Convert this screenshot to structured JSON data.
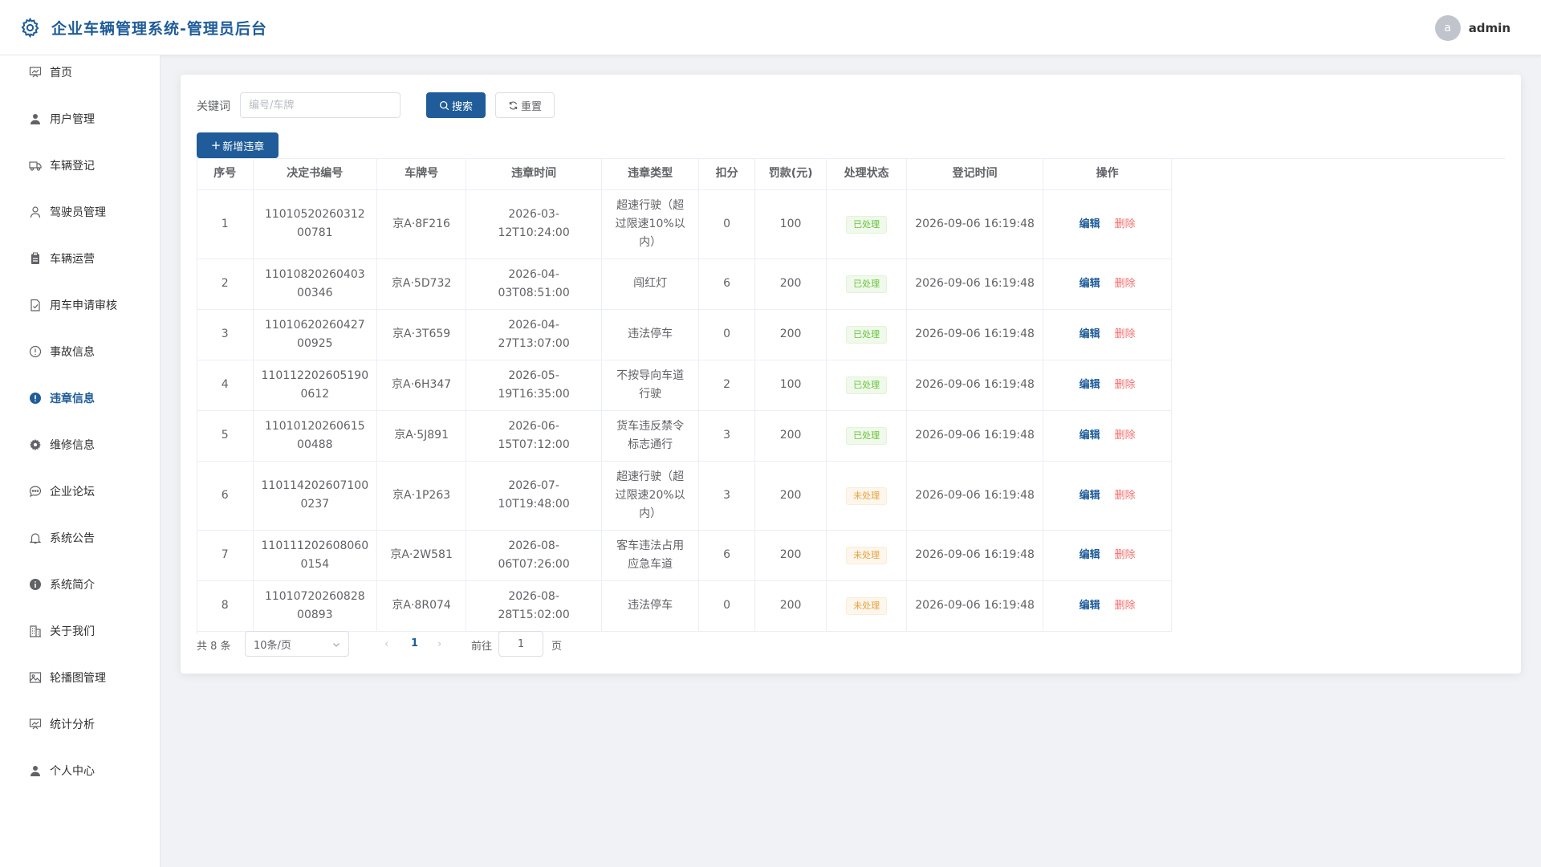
{
  "header": {
    "title": "企业车辆管理系统-管理员后台",
    "avatar_letter": "a",
    "username": "admin"
  },
  "sidebar": {
    "items": [
      {
        "label": "首页",
        "icon": "chart-board-icon",
        "name": "sidebar-item-home"
      },
      {
        "label": "用户管理",
        "icon": "user-icon",
        "name": "sidebar-item-users"
      },
      {
        "label": "车辆登记",
        "icon": "truck-icon",
        "name": "sidebar-item-vehicle-register"
      },
      {
        "label": "驾驶员管理",
        "icon": "user-outline-icon",
        "name": "sidebar-item-drivers"
      },
      {
        "label": "车辆运营",
        "icon": "clipboard-icon",
        "name": "sidebar-item-operations"
      },
      {
        "label": "用车申请审核",
        "icon": "document-check-icon",
        "name": "sidebar-item-applications"
      },
      {
        "label": "事故信息",
        "icon": "warning-outline-icon",
        "name": "sidebar-item-accidents"
      },
      {
        "label": "违章信息",
        "icon": "warning-filled-icon",
        "name": "sidebar-item-violations"
      },
      {
        "label": "维修信息",
        "icon": "gear-icon",
        "name": "sidebar-item-repairs"
      },
      {
        "label": "企业论坛",
        "icon": "chat-icon",
        "name": "sidebar-item-forum"
      },
      {
        "label": "系统公告",
        "icon": "bell-icon",
        "name": "sidebar-item-notices"
      },
      {
        "label": "系统简介",
        "icon": "info-icon",
        "name": "sidebar-item-intro"
      },
      {
        "label": "关于我们",
        "icon": "building-icon",
        "name": "sidebar-item-about"
      },
      {
        "label": "轮播图管理",
        "icon": "picture-icon",
        "name": "sidebar-item-carousel"
      },
      {
        "label": "统计分析",
        "icon": "chart-board-icon",
        "name": "sidebar-item-stats"
      },
      {
        "label": "个人中心",
        "icon": "user-icon",
        "name": "sidebar-item-profile"
      }
    ],
    "active_index": 7
  },
  "toolbar": {
    "keyword_label": "关键词",
    "keyword_placeholder": "编号/车牌",
    "search_label": "搜索",
    "reset_label": "重置",
    "add_label": "新增违章"
  },
  "table": {
    "columns": [
      "序号",
      "决定书编号",
      "车牌号",
      "违章时间",
      "违章类型",
      "扣分",
      "罚款(元)",
      "处理状态",
      "登记时间",
      "操作"
    ],
    "rows": [
      {
        "no": "1",
        "doc": [
          "11010520260312",
          "00781"
        ],
        "plate": "京A·8F216",
        "time": "2026-03-12T10:24:00",
        "type": [
          "超速行驶（超",
          "过限速10%以",
          "内）"
        ],
        "points": "0",
        "fine": "100",
        "status": "已处理",
        "done": true,
        "reg": "2026-09-06 16:19:48"
      },
      {
        "no": "2",
        "doc": [
          "11010820260403",
          "00346"
        ],
        "plate": "京A·5D732",
        "time": "2026-04-03T08:51:00",
        "type": [
          "闯红灯"
        ],
        "points": "6",
        "fine": "200",
        "status": "已处理",
        "done": true,
        "reg": "2026-09-06 16:19:48"
      },
      {
        "no": "3",
        "doc": [
          "11010620260427",
          "00925"
        ],
        "plate": "京A·3T659",
        "time": "2026-04-27T13:07:00",
        "type": [
          "违法停车"
        ],
        "points": "0",
        "fine": "200",
        "status": "已处理",
        "done": true,
        "reg": "2026-09-06 16:19:48"
      },
      {
        "no": "4",
        "doc": [
          "110112202605190",
          "0612"
        ],
        "plate": "京A·6H347",
        "time": "2026-05-19T16:35:00",
        "type": [
          "不按导向车道",
          "行驶"
        ],
        "points": "2",
        "fine": "100",
        "status": "已处理",
        "done": true,
        "reg": "2026-09-06 16:19:48"
      },
      {
        "no": "5",
        "doc": [
          "11010120260615",
          "00488"
        ],
        "plate": "京A·5J891",
        "time": "2026-06-15T07:12:00",
        "type": [
          "货车违反禁令",
          "标志通行"
        ],
        "points": "3",
        "fine": "200",
        "status": "已处理",
        "done": true,
        "reg": "2026-09-06 16:19:48"
      },
      {
        "no": "6",
        "doc": [
          "110114202607100",
          "0237"
        ],
        "plate": "京A·1P263",
        "time": "2026-07-10T19:48:00",
        "type": [
          "超速行驶（超",
          "过限速20%以",
          "内）"
        ],
        "points": "3",
        "fine": "200",
        "status": "未处理",
        "done": false,
        "reg": "2026-09-06 16:19:48"
      },
      {
        "no": "7",
        "doc": [
          "110111202608060",
          "0154"
        ],
        "plate": "京A·2W581",
        "time": "2026-08-06T07:26:00",
        "type": [
          "客车违法占用",
          "应急车道"
        ],
        "points": "6",
        "fine": "200",
        "status": "未处理",
        "done": false,
        "reg": "2026-09-06 16:19:48"
      },
      {
        "no": "8",
        "doc": [
          "11010720260828",
          "00893"
        ],
        "plate": "京A·8R074",
        "time": "2026-08-28T15:02:00",
        "type": [
          "违法停车"
        ],
        "points": "0",
        "fine": "200",
        "status": "未处理",
        "done": false,
        "reg": "2026-09-06 16:19:48"
      }
    ],
    "edit_label": "编辑",
    "delete_label": "删除"
  },
  "pager": {
    "total_text": "共 8 条",
    "page_size": "10条/页",
    "prev": "‹",
    "current": "1",
    "next": "›",
    "goto_label": "前往",
    "goto_value": "1",
    "unit": "页"
  },
  "colors": {
    "primary": "#1f5c99",
    "done": "#67c23a",
    "todo": "#e6a23c",
    "danger": "#f56c6c"
  }
}
